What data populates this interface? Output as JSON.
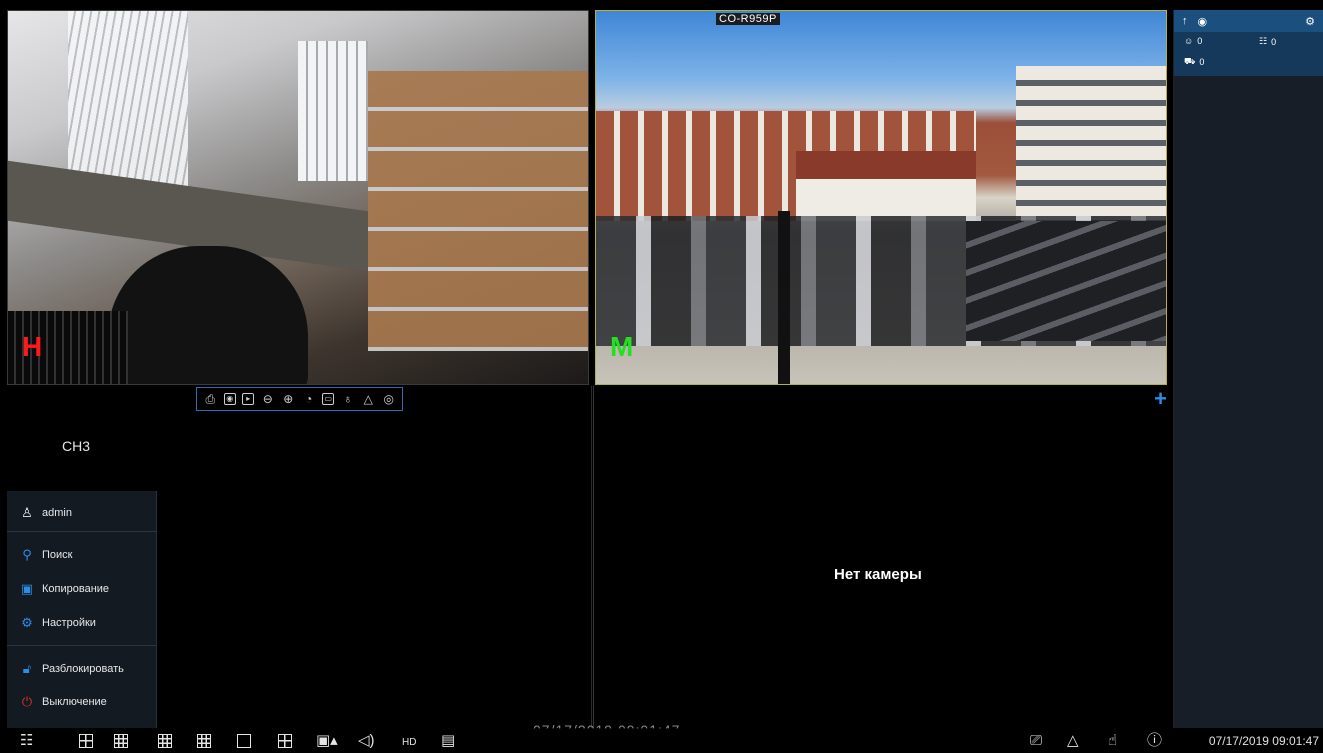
{
  "tiles": {
    "ch1": {
      "channel_mark": "H",
      "mark_color": "#ff1a1a"
    },
    "ch2": {
      "channel_mark": "M",
      "mark_color": "#23e023",
      "camera_title": "CO-R959P"
    },
    "ch3": {
      "label": "CH3"
    },
    "ch4": {
      "status_text": "Нет камеры",
      "add_icon": "+"
    }
  },
  "camera_toolbar": {
    "icons": [
      "record-icon",
      "snapshot-icon",
      "playback-icon",
      "ptz-icon",
      "zoom-icon",
      "color-icon",
      "osd-icon",
      "light-icon",
      "alarm-icon",
      "audio-icon"
    ]
  },
  "main_menu": {
    "user": "admin",
    "items": [
      {
        "label": "Поиск",
        "icon": "search-icon",
        "color": "#2b8de8"
      },
      {
        "label": "Копирование",
        "icon": "backup-icon",
        "color": "#2b8de8"
      },
      {
        "label": "Настройки",
        "icon": "settings-icon",
        "color": "#2b8de8"
      },
      {
        "label": "Разблокировать",
        "icon": "unlock-icon",
        "color": "#2b8de8"
      },
      {
        "label": "Выключение",
        "icon": "power-icon",
        "color": "#e03030"
      }
    ]
  },
  "right_panel": {
    "face_count": "0",
    "people_count": "0",
    "vehicle_count": "0"
  },
  "bottom_bar": {
    "clock": "07/17/2019 09:01:47",
    "ghost_time": "07/17/2019 09:01:47"
  },
  "colors": {
    "accent": "#2b8de8",
    "menu_bg": "#131a22",
    "panel_header": "#1b4f7d"
  }
}
